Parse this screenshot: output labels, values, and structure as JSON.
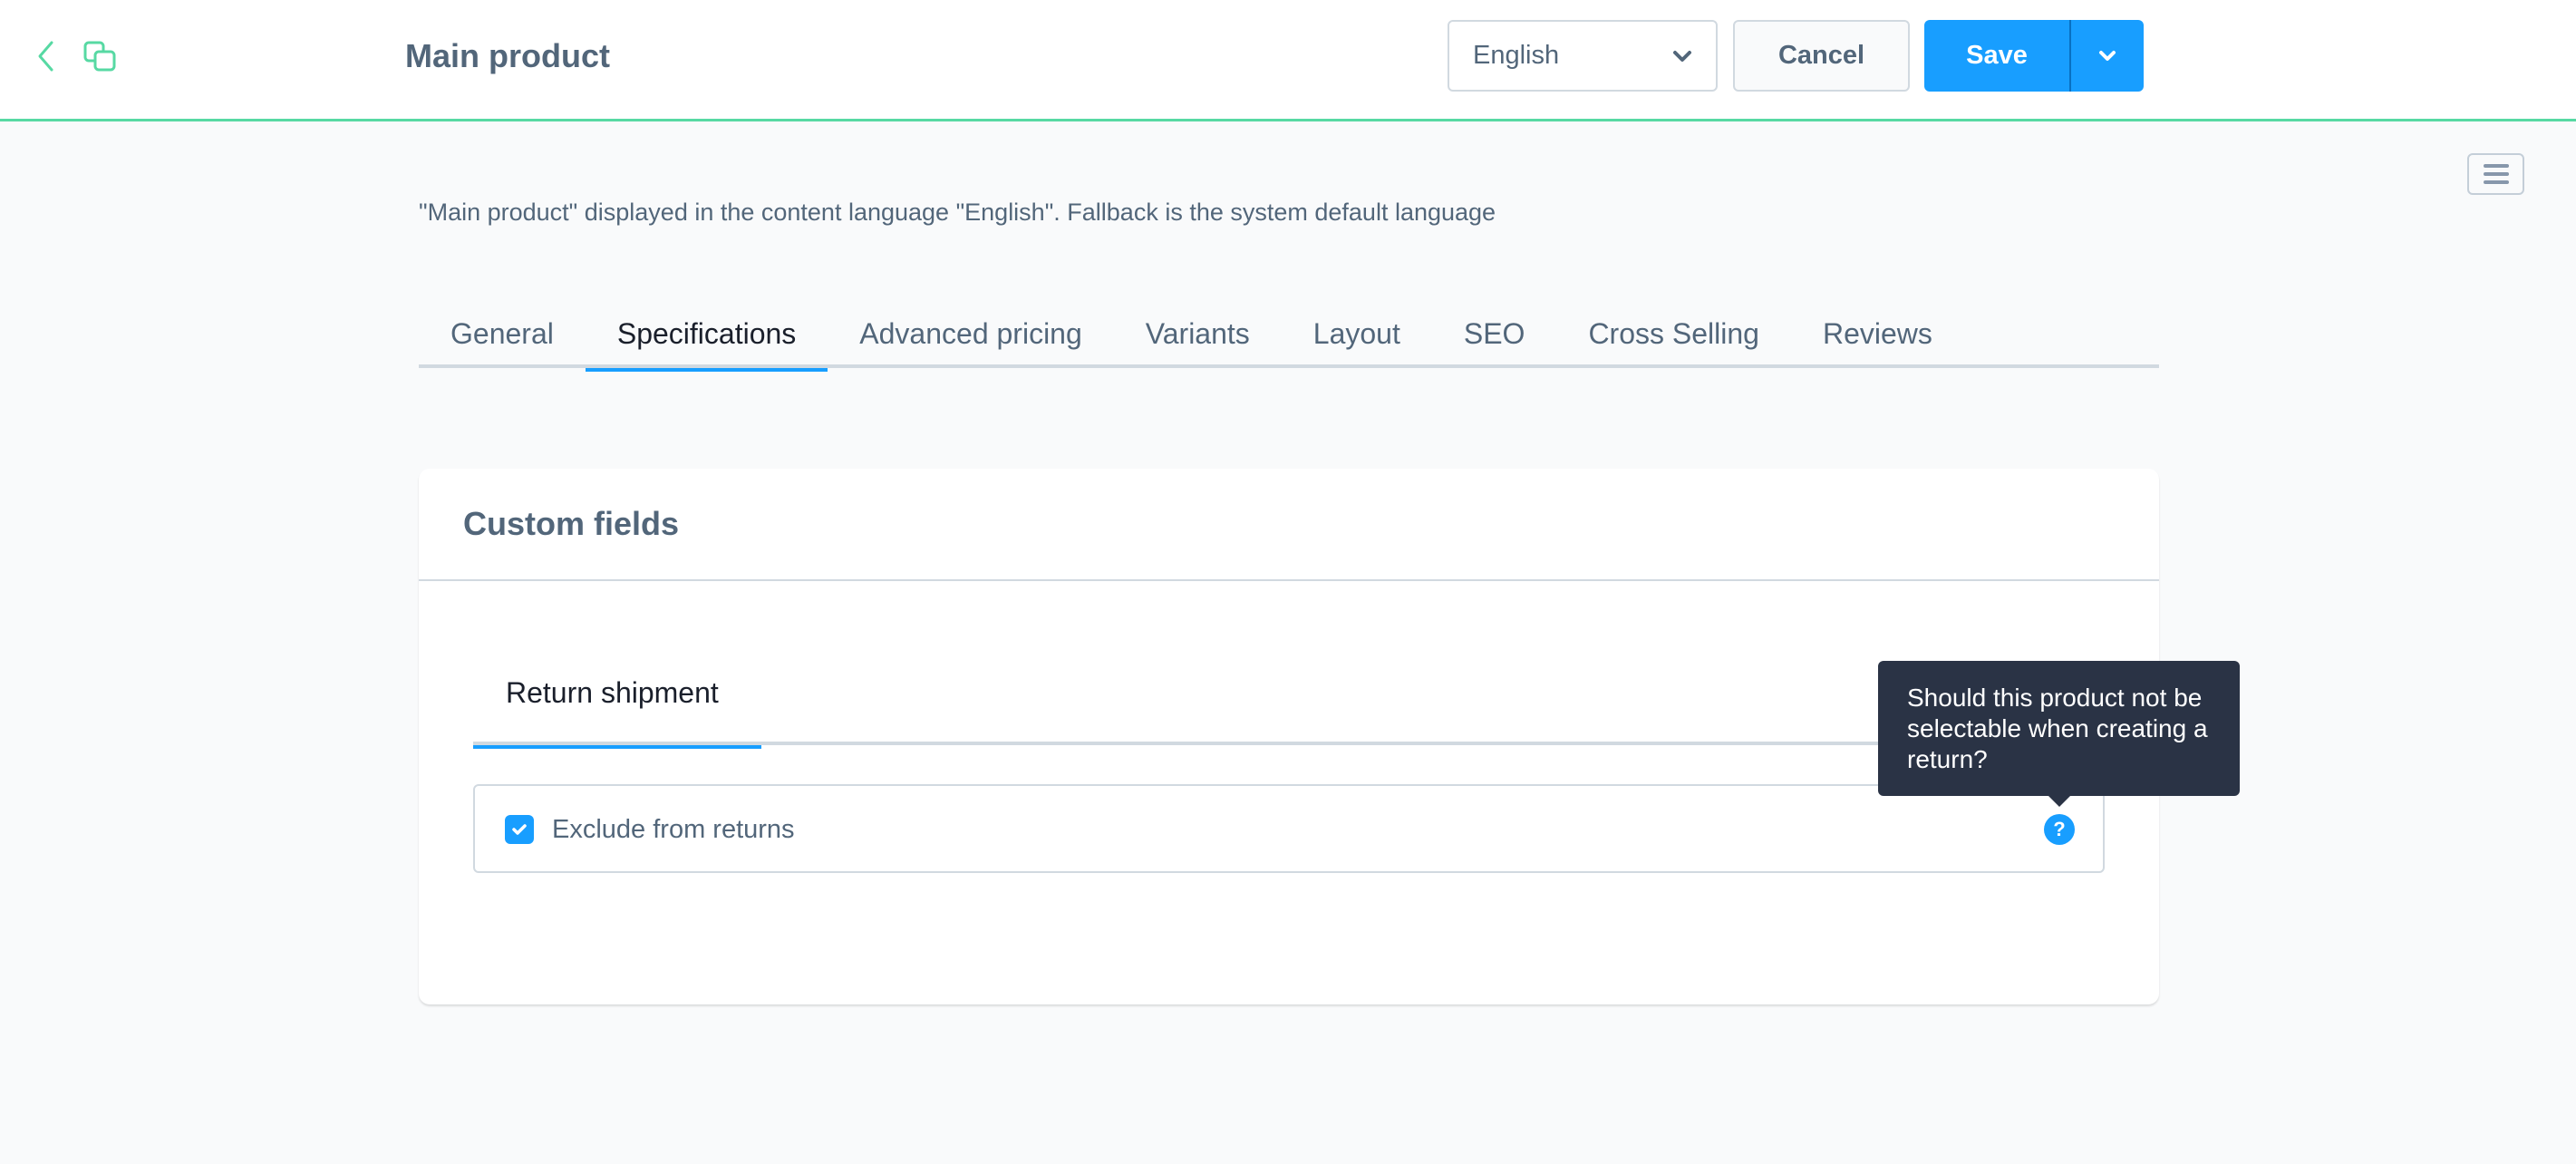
{
  "header": {
    "title": "Main product",
    "language_select": {
      "value": "English"
    },
    "cancel_label": "Cancel",
    "save_label": "Save",
    "icons": {
      "back": "chevron-left-icon",
      "copy": "copy-icon",
      "dropdown": "chevron-down-icon"
    }
  },
  "colors": {
    "accent": "#189eff",
    "header_border": "#57d9a3",
    "text": "#52667a",
    "tooltip_bg": "#2a3345"
  },
  "language_info": "\"Main product\" displayed in the content language \"English\". Fallback is the system default language",
  "tabs": [
    {
      "label": "General",
      "active": false
    },
    {
      "label": "Specifications",
      "active": true
    },
    {
      "label": "Advanced pricing",
      "active": false
    },
    {
      "label": "Variants",
      "active": false
    },
    {
      "label": "Layout",
      "active": false
    },
    {
      "label": "SEO",
      "active": false
    },
    {
      "label": "Cross Selling",
      "active": false
    },
    {
      "label": "Reviews",
      "active": false
    }
  ],
  "card": {
    "title": "Custom fields",
    "inner_tabs": [
      {
        "label": "Return shipment",
        "active": true
      }
    ],
    "fields": [
      {
        "label": "Exclude from returns",
        "checked": true,
        "help": "help-icon"
      }
    ]
  },
  "tooltip": {
    "text": "Should this product not be selectable when creating a return?"
  }
}
